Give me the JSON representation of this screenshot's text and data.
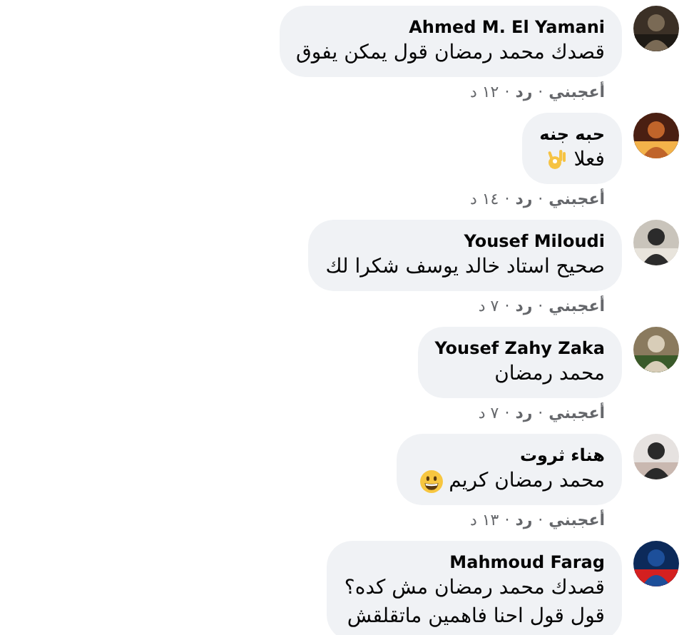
{
  "comments": [
    {
      "author": "Ahmed M. El Yamani",
      "text": "قصدك محمد رمضان قول يمكن يفوق",
      "actions": {
        "like": "أعجبني",
        "separator": "·",
        "reply": "رد",
        "time": "١٢ د"
      }
    },
    {
      "author": "حبه جنه",
      "text": "فعلا",
      "emoji": {
        "kind": "ok-hand"
      },
      "actions": {
        "like": "أعجبني",
        "separator": "·",
        "reply": "رد",
        "time": "١٤ د"
      }
    },
    {
      "author": "Yousef Miloudi",
      "text": "صحيح استاد خالد يوسف شكرا لك",
      "actions": {
        "like": "أعجبني",
        "separator": "·",
        "reply": "رد",
        "time": "٧ د"
      }
    },
    {
      "author": "Yousef Zahy Zaka",
      "text": "محمد رمضان",
      "actions": {
        "like": "أعجبني",
        "separator": "·",
        "reply": "رد",
        "time": "٧ د"
      }
    },
    {
      "author": "هناء ثروت",
      "text": "محمد رمضان كريم",
      "emoji": {
        "kind": "grinning"
      },
      "actions": {
        "like": "أعجبني",
        "separator": "·",
        "reply": "رد",
        "time": "١٣ د"
      }
    },
    {
      "author": "Mahmoud Farag",
      "text": "قصدك محمد رمضان مش كده؟\nقول قول احنا فاهمين ماتقلقش"
    }
  ]
}
